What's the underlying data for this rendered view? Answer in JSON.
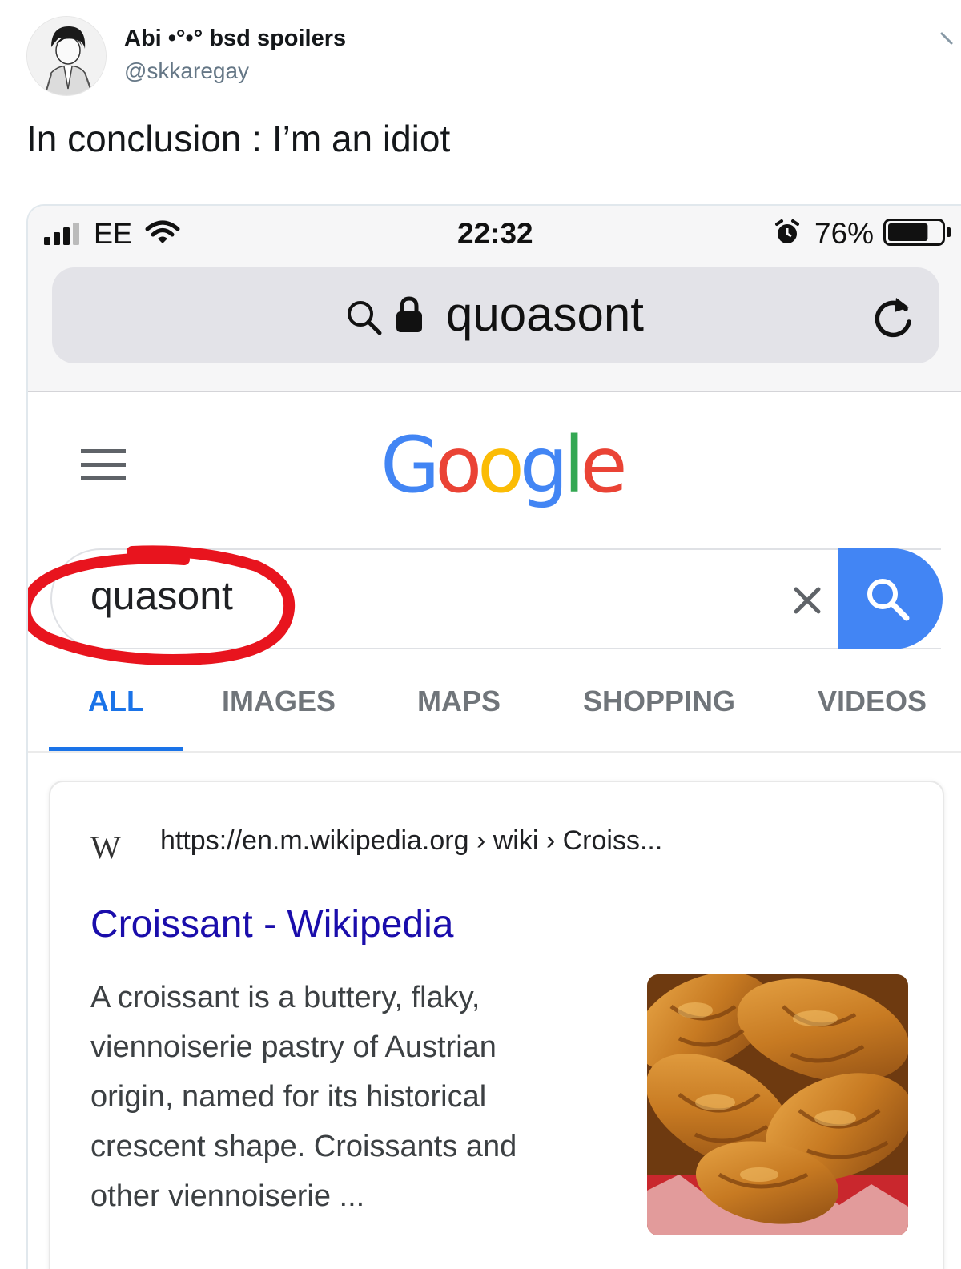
{
  "tweet": {
    "display_name": "Abi •°•° bsd spoilers",
    "handle": "@skkaregay",
    "text": "In conclusion : I’m an idiot",
    "avatar_icon": "anime-character-avatar"
  },
  "status_bar": {
    "carrier": "EE",
    "time": "22:32",
    "battery": "76%",
    "battery_level": 0.76,
    "icons": [
      "signal-bars-icon",
      "wifi-icon",
      "alarm-icon",
      "battery-icon"
    ]
  },
  "address_bar": {
    "text": "quoasont",
    "icons": [
      "search-icon",
      "lock-icon",
      "reload-icon"
    ]
  },
  "google": {
    "logo_letters": [
      "G",
      "o",
      "o",
      "g",
      "l",
      "e"
    ],
    "logo_colors": [
      "#4285F4",
      "#EA4335",
      "#FBBC05",
      "#4285F4",
      "#34A853",
      "#EA4335"
    ],
    "search_query": "quasont",
    "search_button_color": "#4285F4"
  },
  "tabs": [
    {
      "label": "ALL",
      "active": true
    },
    {
      "label": "IMAGES",
      "active": false
    },
    {
      "label": "MAPS",
      "active": false
    },
    {
      "label": "SHOPPING",
      "active": false
    },
    {
      "label": "VIDEOS",
      "active": false
    }
  ],
  "result": {
    "favicon": "W",
    "url": "https://en.m.wikipedia.org › wiki › Croiss...",
    "title": "Croissant - Wikipedia",
    "snippet_lines": [
      "A croissant is a buttery, flaky,",
      "viennoiserie pastry of Austrian",
      "origin, named for its historical",
      "crescent shape. Croissants and",
      "other viennoiserie ..."
    ],
    "thumbnail": "croissants-photo"
  },
  "annotation": {
    "color": "#e8141e",
    "shape": "hand-drawn-circle"
  }
}
